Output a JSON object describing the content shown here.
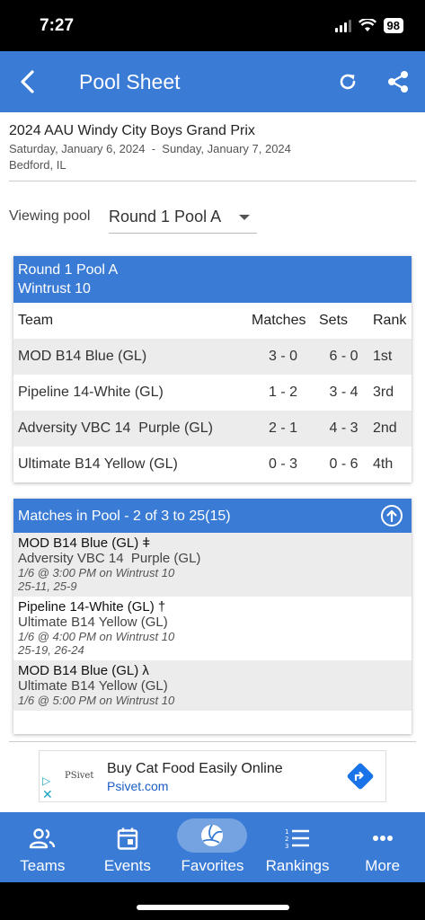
{
  "status": {
    "time": "7:27",
    "battery": "98"
  },
  "app_bar": {
    "title": "Pool Sheet"
  },
  "event": {
    "title": "2024 AAU Windy City Boys Grand Prix",
    "dates": "Saturday, January 6, 2024  -  Sunday, January 7, 2024",
    "location": "Bedford, IL"
  },
  "pool_selector": {
    "label": "Viewing pool",
    "value": "Round 1 Pool A"
  },
  "standings": {
    "header_line1": "Round 1 Pool A",
    "header_line2": "Wintrust 10",
    "columns": [
      "Team",
      "Matches",
      "Sets",
      "Rank"
    ],
    "rows": [
      {
        "team": "MOD B14 Blue (GL)",
        "matches": "3 - 0",
        "sets": "6 - 0",
        "rank": "1st"
      },
      {
        "team": "Pipeline 14-White (GL)",
        "matches": "1 - 2",
        "sets": "3 - 4",
        "rank": "3rd"
      },
      {
        "team": "Adversity VBC 14  Purple (GL)",
        "matches": "2 - 1",
        "sets": "4 - 3",
        "rank": "2nd"
      },
      {
        "team": "Ultimate B14 Yellow (GL)",
        "matches": "0 - 3",
        "sets": "0 - 6",
        "rank": "4th"
      }
    ]
  },
  "matches": {
    "header": "Matches in Pool - 2 of 3 to 25(15)",
    "items": [
      {
        "home": "MOD B14 Blue (GL) ǂ",
        "away": "Adversity VBC 14  Purple (GL)",
        "meta": "1/6 @ 3:00 PM on Wintrust 10",
        "score": "25-11, 25-9"
      },
      {
        "home": "Pipeline 14-White (GL) †",
        "away": "Ultimate B14 Yellow (GL)",
        "meta": "1/6 @ 4:00 PM on Wintrust 10",
        "score": "25-19, 26-24"
      },
      {
        "home": "MOD B14 Blue (GL) λ",
        "away": "Ultimate B14 Yellow (GL)",
        "meta": "1/6 @ 5:00 PM on Wintrust 10",
        "score": ""
      }
    ]
  },
  "ad": {
    "logo": "PSivet",
    "title": "Buy Cat Food Easily Online",
    "url": "Psivet.com"
  },
  "bottom_nav": {
    "items": [
      {
        "label": "Teams",
        "icon": "people-icon"
      },
      {
        "label": "Events",
        "icon": "calendar-icon"
      },
      {
        "label": "Favorites",
        "icon": "volleyball-icon",
        "active": true
      },
      {
        "label": "Rankings",
        "icon": "list-numbered-icon"
      },
      {
        "label": "More",
        "icon": "more-dots-icon"
      }
    ]
  },
  "colors": {
    "primary": "#3a7bd5",
    "row_alt": "#ececec"
  }
}
